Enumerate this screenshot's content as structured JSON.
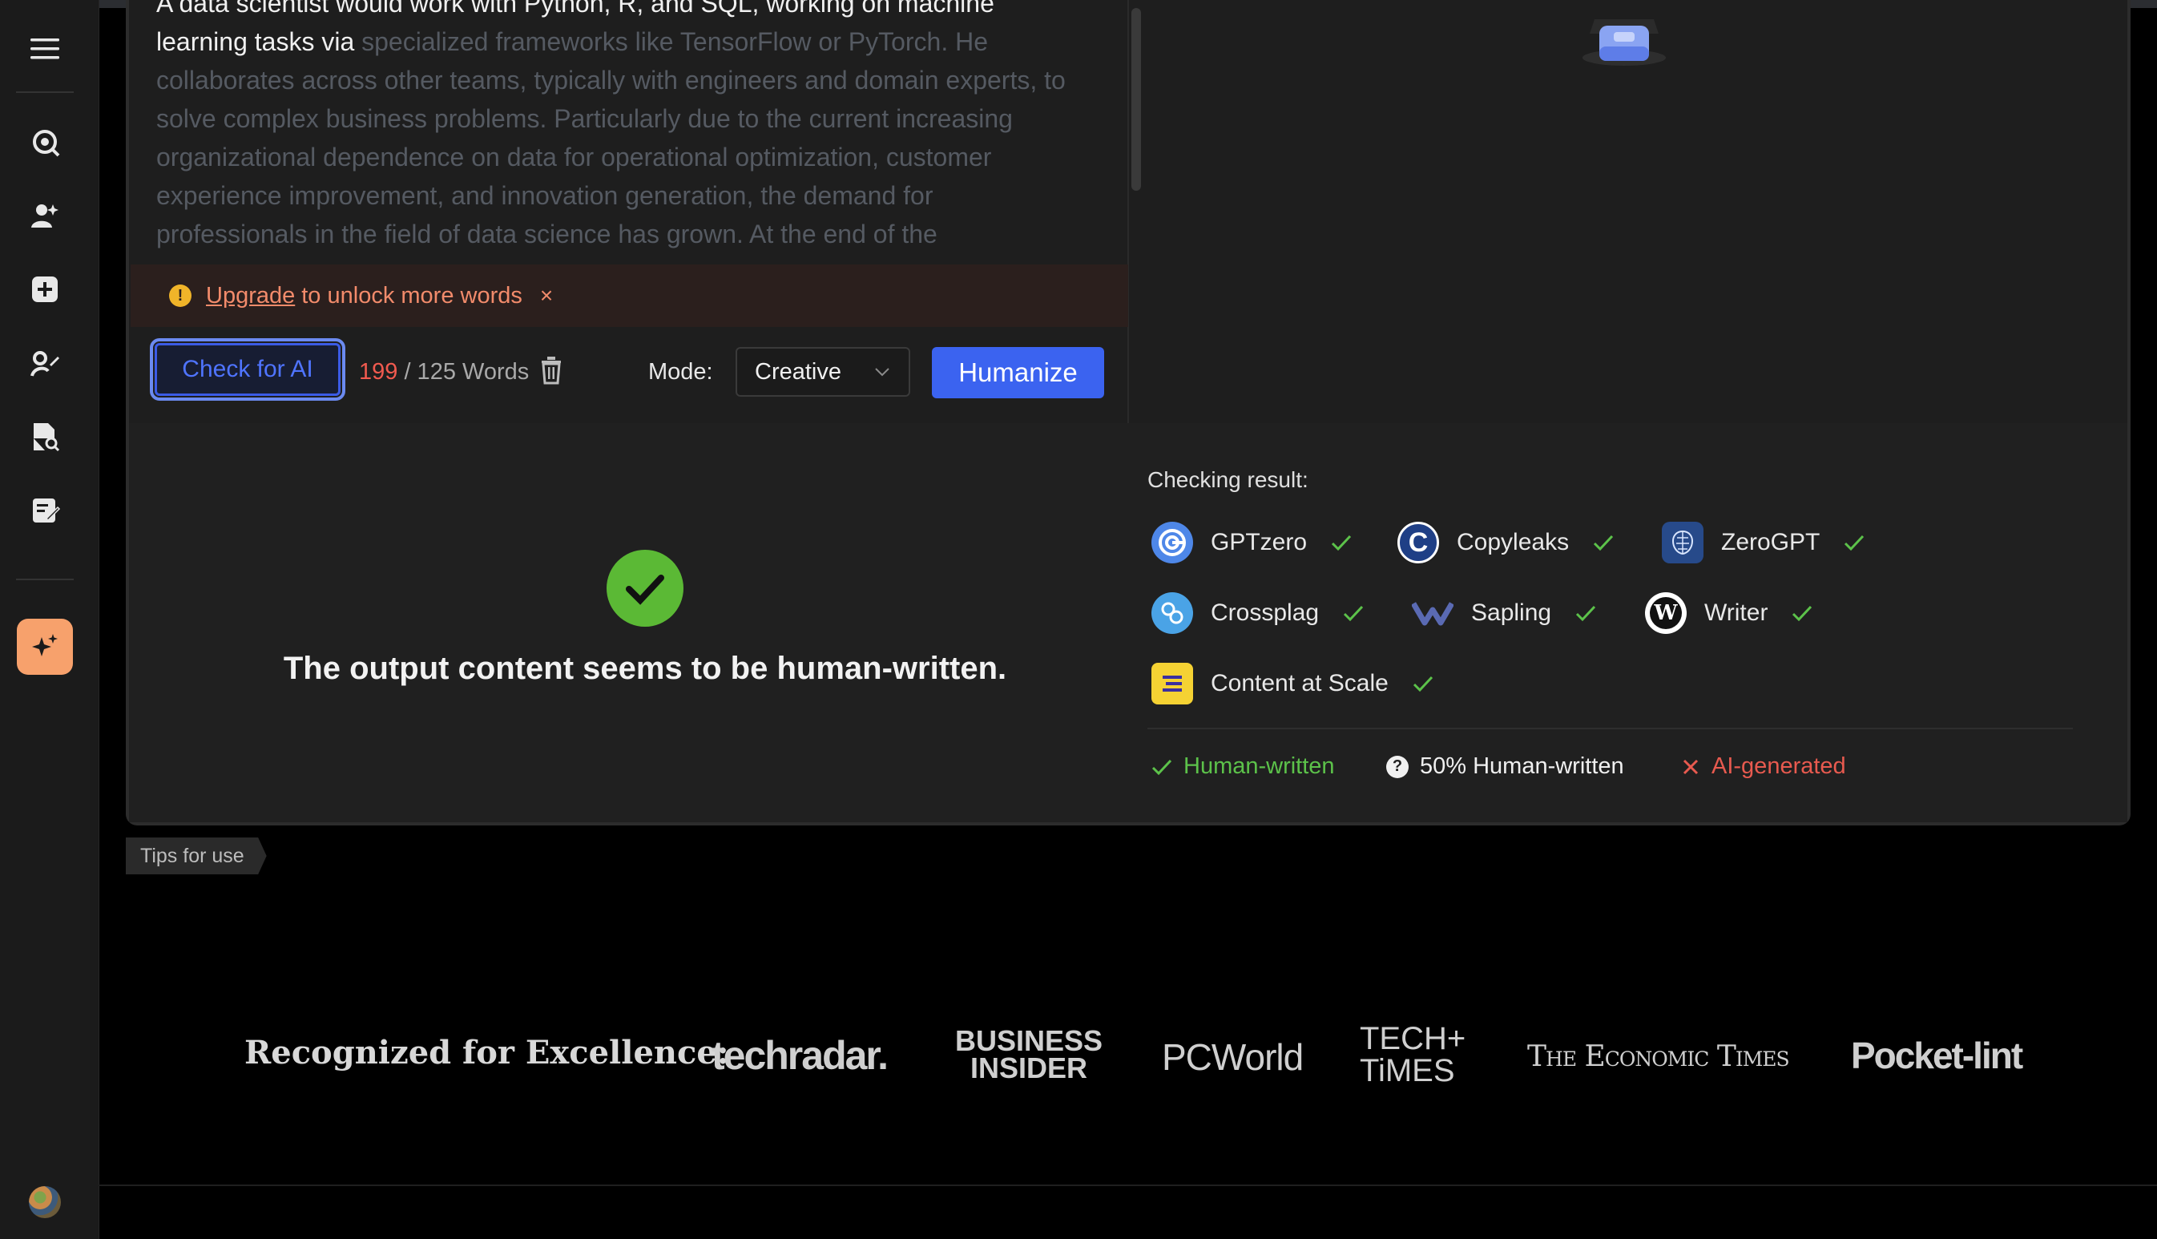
{
  "sidebar": {
    "items": [
      {
        "icon": "menu-icon"
      },
      {
        "icon": "ai-detector-icon"
      },
      {
        "icon": "humanizer-icon"
      },
      {
        "icon": "add-icon"
      },
      {
        "icon": "paraphraser-icon"
      },
      {
        "icon": "document-search-icon"
      },
      {
        "icon": "grammar-check-icon"
      },
      {
        "icon": "sparkle-icon"
      }
    ],
    "active_color": "#f7a16c"
  },
  "editor": {
    "text_bright": "A data scientist would work with Python, R, and SQL, working on machine learning tasks via",
    "text_dim": " specialized frameworks like TensorFlow or PyTorch. He collaborates across other teams, typically with engineers and domain experts, to solve complex business problems. Particularly due to the current increasing organizational dependence on data for operational optimization, customer experience improvement, and innovation generation, the demand for professionals in the field of data science has grown. At the end of the"
  },
  "upgrade_bar": {
    "link": "Upgrade",
    "text": "to unlock more words",
    "close": "×"
  },
  "toolbar": {
    "check_ai_label": "Check for AI",
    "words_used": "199",
    "words_rest": " / 125 Words",
    "mode_label": "Mode:",
    "mode_value": "Creative",
    "humanize_label": "Humanize"
  },
  "result": {
    "message": "The output content seems to be human-written.",
    "checking_label": "Checking result:",
    "detectors": [
      {
        "name": "GPTzero",
        "status": "human"
      },
      {
        "name": "Copyleaks",
        "status": "human"
      },
      {
        "name": "ZeroGPT",
        "status": "human"
      },
      {
        "name": "Crossplag",
        "status": "human"
      },
      {
        "name": "Sapling",
        "status": "human"
      },
      {
        "name": "Writer",
        "status": "human"
      },
      {
        "name": "Content at Scale",
        "status": "human"
      }
    ],
    "legend": {
      "human": "Human-written",
      "half": "50% Human-written",
      "ai": "AI-generated"
    },
    "colors": {
      "human": "#5cc24a",
      "ai": "#e85a4f",
      "primary": "#3b63f0"
    }
  },
  "tips_tab": "Tips for use",
  "recognition": {
    "label": "Recognized for Excellence:",
    "logos": {
      "techradar": "techradar.",
      "business_insider_1": "BUSINESS",
      "business_insider_2": "INSIDER",
      "pcworld": "PCWorld",
      "techtimes_1": "TECH+",
      "techtimes_2": "TiMES",
      "economic_times": "The Economic Times",
      "pocketlint": "Pocket-lint"
    }
  }
}
